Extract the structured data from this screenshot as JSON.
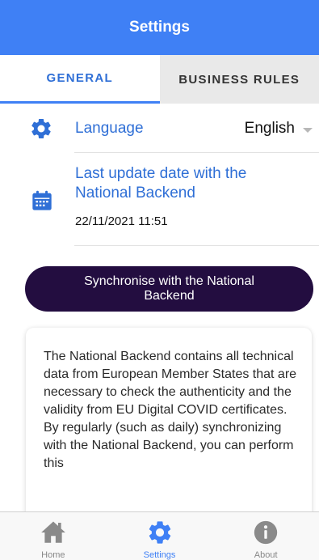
{
  "header": {
    "title": "Settings"
  },
  "tabs": [
    {
      "label": "GENERAL",
      "active": true
    },
    {
      "label": "BUSINESS RULES",
      "active": false
    }
  ],
  "settings": {
    "language": {
      "label": "Language",
      "value": "English",
      "icon": "gear-icon"
    },
    "last_update": {
      "label": "Last update date with the National Backend",
      "date": "22/11/2021 11:51",
      "icon": "calendar-icon"
    }
  },
  "sync_button": {
    "label": "Synchronise with the National Backend"
  },
  "info_card": {
    "text": "The National Backend contains all technical data from European Member States that are necessary to check the authenticity and the validity from EU Digital COVID certificates.\nBy regularly (such as daily) synchronizing with the National Backend, you can perform this"
  },
  "tabbar": [
    {
      "label": "Home",
      "icon": "home-icon",
      "active": false
    },
    {
      "label": "Settings",
      "icon": "gear-icon",
      "active": true
    },
    {
      "label": "About",
      "icon": "info-icon",
      "active": false
    }
  ],
  "colors": {
    "accent": "#3f80f5",
    "link_text": "#2f6fd6",
    "sync_button_bg": "#230d40",
    "inactive_tab_bg": "#e9e9e9"
  }
}
